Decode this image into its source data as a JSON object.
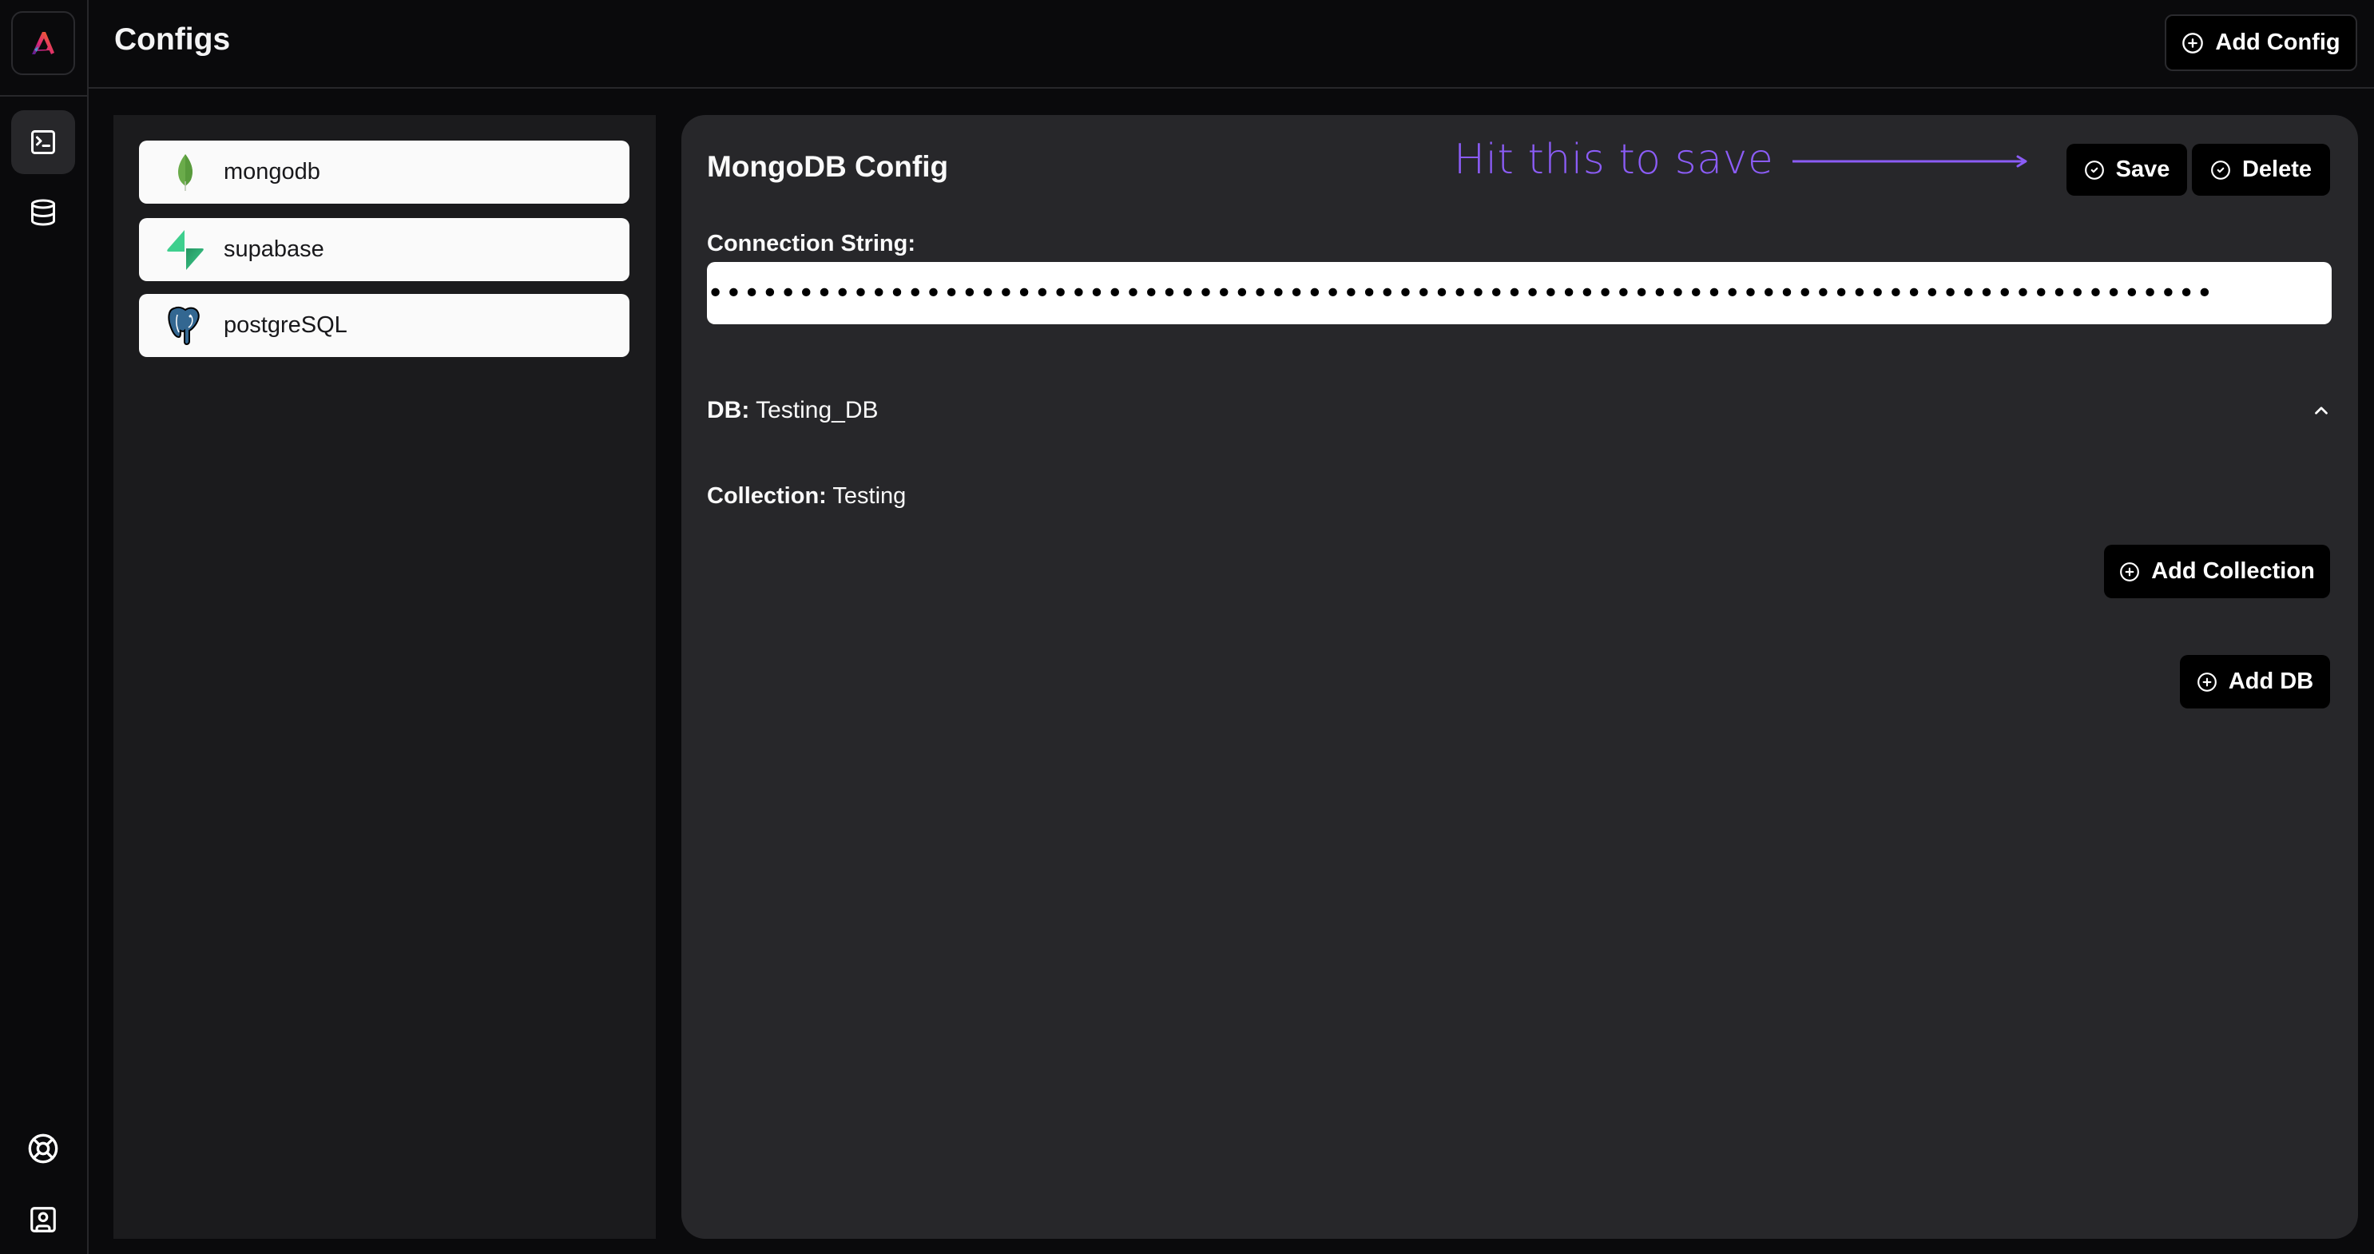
{
  "app": {
    "logo": "app-logo-a",
    "page_title": "Configs"
  },
  "rail": {
    "top_items": [
      {
        "name": "configs",
        "icon": "terminal-icon",
        "active": true
      },
      {
        "name": "databases",
        "icon": "database-icon",
        "active": false
      }
    ],
    "bottom_items": [
      {
        "name": "support",
        "icon": "lifebuoy-icon"
      },
      {
        "name": "profile",
        "icon": "contact-icon"
      }
    ]
  },
  "header": {
    "add_config_label": "Add Config"
  },
  "configs_list": [
    {
      "label": "mongodb",
      "icon": "mongodb-leaf-icon"
    },
    {
      "label": "supabase",
      "icon": "supabase-bolt-icon"
    },
    {
      "label": "postgreSQL",
      "icon": "postgres-elephant-icon"
    }
  ],
  "editor": {
    "title": "MongoDB Config",
    "annotation": "Hit this to save",
    "save_label": "Save",
    "delete_label": "Delete",
    "connection_label": "Connection String:",
    "connection_value": "•••••••••••••••••••••••••••••••••••••••••••••••••••••••••••••••••••••••••••••••••••",
    "db": {
      "key_label": "DB:",
      "name": "Testing_DB",
      "expanded": true,
      "collections": [
        {
          "key_label": "Collection:",
          "name": "Testing"
        }
      ]
    },
    "add_collection_label": "Add Collection",
    "add_db_label": "Add DB"
  },
  "colors": {
    "accent_annotation": "#8b5cf6",
    "panel_bg": "#27272a",
    "list_bg": "#1b1b1d",
    "page_bg": "#0a0a0c"
  }
}
